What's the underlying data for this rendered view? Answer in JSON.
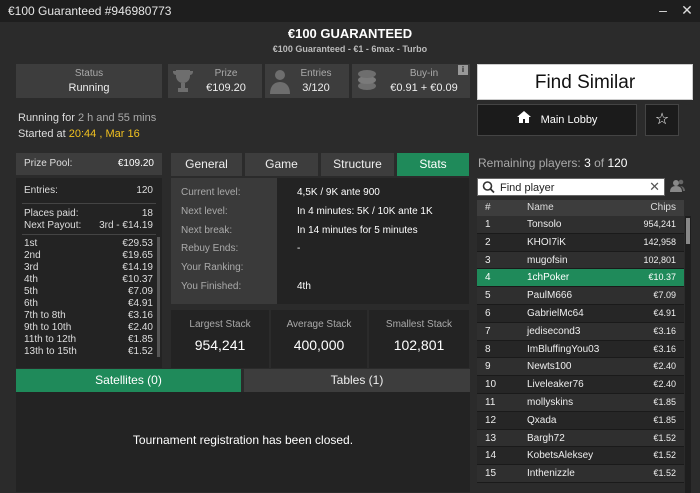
{
  "window": {
    "title": "€100 Guaranteed #946980773",
    "minimize": "–",
    "close": "✕"
  },
  "header": {
    "title": "€100 GUARANTEED",
    "subtitle": "€100 Guaranteed - €1 - 6max - Turbo"
  },
  "info": {
    "status": {
      "label": "Status",
      "value": "Running"
    },
    "prize": {
      "label": "Prize",
      "value": "€109.20",
      "icon": "trophy-icon"
    },
    "entries": {
      "label": "Entries",
      "value": "3/120",
      "icon": "user-icon"
    },
    "buyin": {
      "label": "Buy-in",
      "value": "€0.91 + €0.09",
      "icon": "chips-icon",
      "info": "i"
    }
  },
  "actions": {
    "find_similar": "Find Similar",
    "main_lobby": "Main Lobby",
    "star": "☆"
  },
  "running": {
    "running_prefix": "Running for ",
    "running_value": "2 h and 55 mins",
    "started_prefix": "Started at ",
    "started_value": "20:44 , Mar 16"
  },
  "prizes": {
    "pool_label": "Prize Pool:",
    "pool_value": "€109.20",
    "entries_label": "Entries:",
    "entries_value": "120",
    "places_label": "Places paid:",
    "places_value": "18",
    "next_label": "Next Payout:",
    "next_value": "3rd - €14.19",
    "rows": [
      {
        "place": "1st",
        "amount": "€29.53"
      },
      {
        "place": "2nd",
        "amount": "€19.65"
      },
      {
        "place": "3rd",
        "amount": "€14.19"
      },
      {
        "place": "4th",
        "amount": "€10.37"
      },
      {
        "place": "5th",
        "amount": "€7.09"
      },
      {
        "place": "6th",
        "amount": "€4.91"
      },
      {
        "place": "7th to 8th",
        "amount": "€3.16"
      },
      {
        "place": "9th to 10th",
        "amount": "€2.40"
      },
      {
        "place": "11th to 12th",
        "amount": "€1.85"
      },
      {
        "place": "13th to 15th",
        "amount": "€1.52"
      }
    ]
  },
  "tabs": [
    "General",
    "Game",
    "Structure",
    "Stats"
  ],
  "stats": {
    "rows": [
      {
        "label": "Current level:",
        "value": "4,5K / 9K ante 900"
      },
      {
        "label": "Next level:",
        "value": "In 4 minutes: 5K / 10K ante 1K"
      },
      {
        "label": "Next break:",
        "value": "In 14 minutes for 5 minutes"
      },
      {
        "label": "Rebuy Ends:",
        "value": "-"
      },
      {
        "label": "Your Ranking:",
        "value": ""
      },
      {
        "label": "You Finished:",
        "value": "4th"
      }
    ],
    "largest_label": "Largest Stack",
    "largest_value": "954,241",
    "average_label": "Average Stack",
    "average_value": "400,000",
    "smallest_label": "Smallest Stack",
    "smallest_value": "102,801"
  },
  "bottom_tabs": {
    "satellites": "Satellites (0)",
    "tables": "Tables (1)"
  },
  "closed_message": "Tournament registration has been closed.",
  "players": {
    "remaining_label": "Remaining players: ",
    "remaining_count": "3",
    "of_label": " of ",
    "total": "120",
    "search_placeholder": "Find player",
    "columns": {
      "num": "#",
      "name": "Name",
      "chips": "Chips"
    },
    "rows": [
      {
        "num": "1",
        "name": "Tonsolo",
        "chips": "954,241"
      },
      {
        "num": "2",
        "name": "KHOI7iK",
        "chips": "142,958"
      },
      {
        "num": "3",
        "name": "mugofsin",
        "chips": "102,801"
      },
      {
        "num": "4",
        "name": "1chPoker",
        "chips": "€10.37"
      },
      {
        "num": "5",
        "name": "PaulM666",
        "chips": "€7.09"
      },
      {
        "num": "6",
        "name": "GabrielMc64",
        "chips": "€4.91"
      },
      {
        "num": "7",
        "name": "jedisecond3",
        "chips": "€3.16"
      },
      {
        "num": "8",
        "name": "ImBluffingYou03",
        "chips": "€3.16"
      },
      {
        "num": "9",
        "name": "Newts100",
        "chips": "€2.40"
      },
      {
        "num": "10",
        "name": "Liveleaker76",
        "chips": "€2.40"
      },
      {
        "num": "11",
        "name": "mollyskins",
        "chips": "€1.85"
      },
      {
        "num": "12",
        "name": "Qxada",
        "chips": "€1.85"
      },
      {
        "num": "13",
        "name": "Bargh72",
        "chips": "€1.52"
      },
      {
        "num": "14",
        "name": "KobetsAleksey",
        "chips": "€1.52"
      },
      {
        "num": "15",
        "name": "Inthenizzle",
        "chips": "€1.52"
      }
    ]
  },
  "colors": {
    "accent": "#1f8a5a",
    "highlight_time": "#f0c020"
  }
}
